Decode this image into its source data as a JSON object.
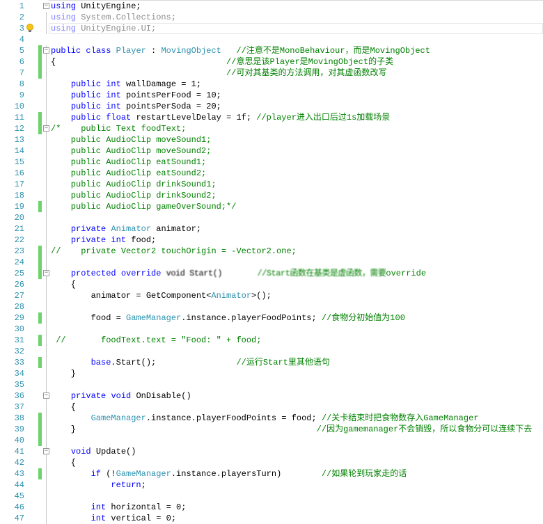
{
  "editor": {
    "change_bar_color": "#6ed36e",
    "current_line": 3,
    "lines": [
      {
        "n": "1",
        "fold": true,
        "tokens": [
          [
            "using",
            "kw"
          ],
          [
            " UnityEngine;",
            ""
          ]
        ]
      },
      {
        "n": "2",
        "tokens": [
          [
            "using",
            "dimkw"
          ],
          [
            " System.Collections;",
            "dim"
          ]
        ]
      },
      {
        "n": "3",
        "bulb": true,
        "tokens": [
          [
            "using",
            "dimkw"
          ],
          [
            " UnityEngine.UI;",
            "dim"
          ]
        ]
      },
      {
        "n": "4",
        "tokens": []
      },
      {
        "n": "5",
        "bar": true,
        "fold": true,
        "tokens": [
          [
            "public",
            "kw"
          ],
          [
            " ",
            ""
          ],
          [
            "class",
            "kw"
          ],
          [
            " ",
            ""
          ],
          [
            "Player",
            "ty"
          ],
          [
            " : ",
            ""
          ],
          [
            "MovingObject",
            "ty"
          ],
          [
            "   ",
            ""
          ],
          [
            "//注意不是MonoBehaviour，而是MovingObject",
            "cm"
          ]
        ]
      },
      {
        "n": "6",
        "bar": true,
        "tokens": [
          [
            "{                                  ",
            ""
          ],
          [
            "//意思是该Player是MovingObject的子类",
            "cm"
          ]
        ]
      },
      {
        "n": "7",
        "bar": true,
        "tokens": [
          [
            "                                   ",
            ""
          ],
          [
            "//可对其基类的方法调用，对其虚函数改写",
            "cm"
          ]
        ]
      },
      {
        "n": "8",
        "tokens": [
          [
            "    ",
            ""
          ],
          [
            "public",
            "kw"
          ],
          [
            " ",
            ""
          ],
          [
            "int",
            "kw"
          ],
          [
            " wallDamage = 1;",
            ""
          ]
        ]
      },
      {
        "n": "9",
        "tokens": [
          [
            "    ",
            ""
          ],
          [
            "public",
            "kw"
          ],
          [
            " ",
            ""
          ],
          [
            "int",
            "kw"
          ],
          [
            " pointsPerFood = 10;",
            ""
          ]
        ]
      },
      {
        "n": "10",
        "tokens": [
          [
            "    ",
            ""
          ],
          [
            "public",
            "kw"
          ],
          [
            " ",
            ""
          ],
          [
            "int",
            "kw"
          ],
          [
            " pointsPerSoda = 20;",
            ""
          ]
        ]
      },
      {
        "n": "11",
        "bar": true,
        "tokens": [
          [
            "    ",
            ""
          ],
          [
            "public",
            "kw"
          ],
          [
            " ",
            ""
          ],
          [
            "float",
            "kw"
          ],
          [
            " restartLevelDelay = 1f; ",
            ""
          ],
          [
            "//player进入出口后过1s加载场景",
            "cm"
          ]
        ]
      },
      {
        "n": "12",
        "bar": true,
        "fold": true,
        "tokens": [
          [
            "/*    public Text foodText;",
            "cm"
          ]
        ]
      },
      {
        "n": "13",
        "tokens": [
          [
            "    public AudioClip moveSound1;",
            "cm"
          ]
        ]
      },
      {
        "n": "14",
        "tokens": [
          [
            "    public AudioClip moveSound2;",
            "cm"
          ]
        ]
      },
      {
        "n": "15",
        "tokens": [
          [
            "    public AudioClip eatSound1;",
            "cm"
          ]
        ]
      },
      {
        "n": "16",
        "tokens": [
          [
            "    public AudioClip eatSound2;",
            "cm"
          ]
        ]
      },
      {
        "n": "17",
        "tokens": [
          [
            "    public AudioClip drinkSound1;",
            "cm"
          ]
        ]
      },
      {
        "n": "18",
        "tokens": [
          [
            "    public AudioClip drinkSound2;",
            "cm"
          ]
        ]
      },
      {
        "n": "19",
        "bar": true,
        "tokens": [
          [
            "    public AudioClip gameOverSound;*/",
            "cm"
          ]
        ]
      },
      {
        "n": "20",
        "tokens": []
      },
      {
        "n": "21",
        "tokens": [
          [
            "    ",
            ""
          ],
          [
            "private",
            "kw"
          ],
          [
            " ",
            ""
          ],
          [
            "Animator",
            "ty"
          ],
          [
            " animator;",
            ""
          ]
        ]
      },
      {
        "n": "22",
        "tokens": [
          [
            "    ",
            ""
          ],
          [
            "private",
            "kw"
          ],
          [
            " ",
            ""
          ],
          [
            "int",
            "kw"
          ],
          [
            " food;",
            ""
          ]
        ]
      },
      {
        "n": "23",
        "bar": true,
        "tokens": [
          [
            "//    private Vector2 touchOrigin = -Vector2.one;",
            "cm"
          ]
        ]
      },
      {
        "n": "24",
        "bar": true,
        "tokens": []
      },
      {
        "n": "25",
        "bar": true,
        "fold": true,
        "tokens": [
          [
            "    ",
            ""
          ],
          [
            "protected",
            "kw"
          ],
          [
            " ",
            ""
          ],
          [
            "override",
            "kw"
          ],
          [
            " ",
            ""
          ],
          [
            "void Start()",
            "blur"
          ],
          [
            "       ",
            ""
          ],
          [
            "//Start函数在基类是虚函数，需要",
            "cm blur"
          ],
          [
            "override",
            "cm"
          ]
        ]
      },
      {
        "n": "26",
        "tokens": [
          [
            "    {",
            ""
          ]
        ]
      },
      {
        "n": "27",
        "tokens": [
          [
            "        animator = GetComponent<",
            ""
          ],
          [
            "Animator",
            "ty"
          ],
          [
            ">();",
            ""
          ]
        ]
      },
      {
        "n": "28",
        "tokens": []
      },
      {
        "n": "29",
        "bar": true,
        "tokens": [
          [
            "        food = ",
            ""
          ],
          [
            "GameManager",
            "ty"
          ],
          [
            ".instance.playerFoodPoints; ",
            ""
          ],
          [
            "//食物分初始值为100",
            "cm"
          ]
        ]
      },
      {
        "n": "30",
        "tokens": []
      },
      {
        "n": "31",
        "bar": true,
        "tokens": [
          [
            " //       foodText.text = \"Food: \" + food;",
            "cm"
          ]
        ]
      },
      {
        "n": "32",
        "tokens": []
      },
      {
        "n": "33",
        "bar": true,
        "tokens": [
          [
            "        ",
            ""
          ],
          [
            "base",
            "kw"
          ],
          [
            ".Start();                ",
            ""
          ],
          [
            "//运行Start里其他语句",
            "cm"
          ]
        ]
      },
      {
        "n": "34",
        "tokens": [
          [
            "    }",
            ""
          ]
        ]
      },
      {
        "n": "35",
        "tokens": []
      },
      {
        "n": "36",
        "fold": true,
        "tokens": [
          [
            "    ",
            ""
          ],
          [
            "private",
            "kw"
          ],
          [
            " ",
            ""
          ],
          [
            "void",
            "kw"
          ],
          [
            " OnDisable()",
            ""
          ]
        ]
      },
      {
        "n": "37",
        "tokens": [
          [
            "    {",
            ""
          ]
        ]
      },
      {
        "n": "38",
        "bar": true,
        "tokens": [
          [
            "        ",
            ""
          ],
          [
            "GameManager",
            "ty"
          ],
          [
            ".instance.playerFoodPoints = food; ",
            ""
          ],
          [
            "//关卡结束时把食物数存入GameManager",
            "cm"
          ]
        ]
      },
      {
        "n": "39",
        "bar": true,
        "tokens": [
          [
            "    }                                                ",
            ""
          ],
          [
            "//因为gamemanager不会销毁，所以食物分可以连续下去",
            "cm"
          ]
        ]
      },
      {
        "n": "40",
        "bar": true,
        "tokens": []
      },
      {
        "n": "41",
        "fold": true,
        "tokens": [
          [
            "    ",
            ""
          ],
          [
            "void",
            "kw"
          ],
          [
            " Update()",
            ""
          ]
        ]
      },
      {
        "n": "42",
        "tokens": [
          [
            "    {",
            ""
          ]
        ]
      },
      {
        "n": "43",
        "bar": true,
        "tokens": [
          [
            "        ",
            ""
          ],
          [
            "if",
            "kw"
          ],
          [
            " (!",
            ""
          ],
          [
            "GameManager",
            "ty"
          ],
          [
            ".instance.playersTurn)        ",
            ""
          ],
          [
            "//如果轮到玩家走的话",
            "cm"
          ]
        ]
      },
      {
        "n": "44",
        "tokens": [
          [
            "            ",
            ""
          ],
          [
            "return",
            "kw"
          ],
          [
            ";",
            ""
          ]
        ]
      },
      {
        "n": "45",
        "tokens": []
      },
      {
        "n": "46",
        "tokens": [
          [
            "        ",
            ""
          ],
          [
            "int",
            "kw"
          ],
          [
            " horizontal = 0;",
            ""
          ]
        ]
      },
      {
        "n": "47",
        "tokens": [
          [
            "        ",
            ""
          ],
          [
            "int",
            "kw"
          ],
          [
            " vertical = 0;",
            ""
          ]
        ]
      }
    ]
  }
}
